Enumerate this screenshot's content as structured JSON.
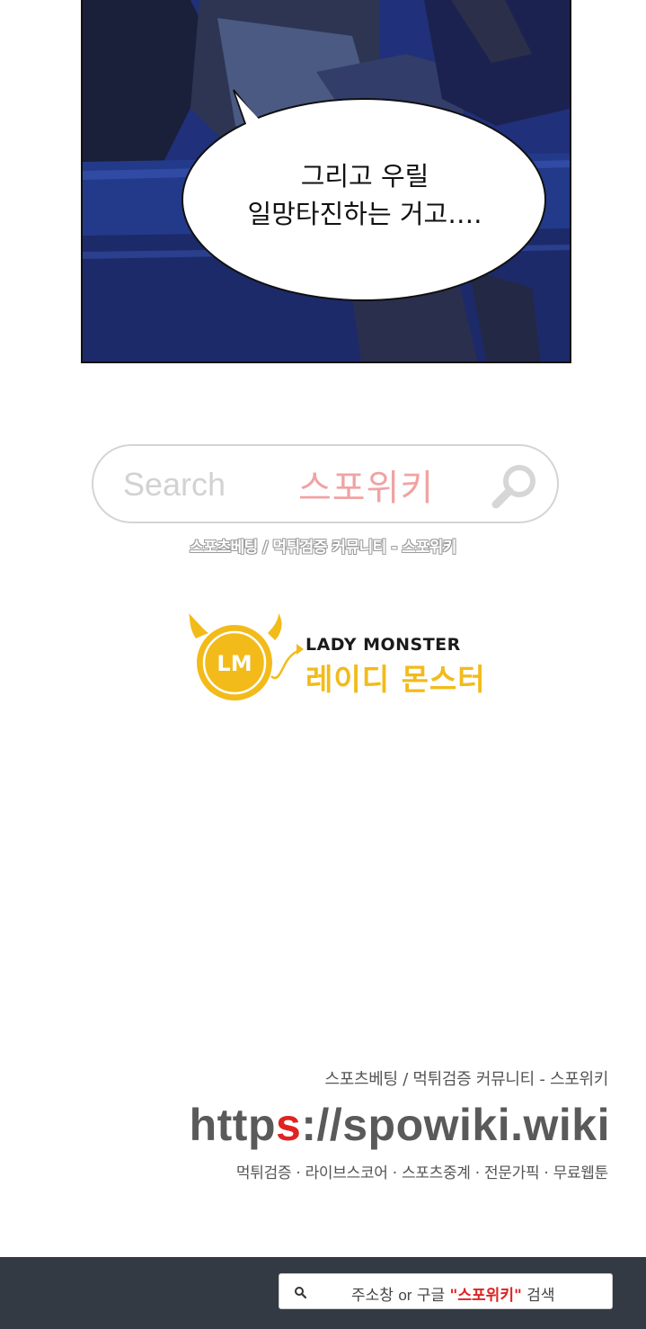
{
  "comic": {
    "speech_line_1": "그리고 우릴",
    "speech_line_2": "일망타진하는 거고…."
  },
  "search_banner": {
    "placeholder": "Search",
    "brand": "스포위키",
    "caption": "스포츠베팅 / 먹튀검증 커뮤니티 - 스포위키"
  },
  "logo": {
    "initials": "LM",
    "name_en": "LADY MONSTER",
    "name_ko": "레이디 몬스터",
    "accent_color": "#f2bb1a"
  },
  "footer": {
    "tagline": "스포츠베팅 / 먹튀검증 커뮤니티 - 스포위키",
    "url_part1": "http",
    "url_accent": "s",
    "url_part2": "://spowiki.wiki",
    "services": "먹튀검증 · 라이브스코어 · 스포츠중계 · 전문가픽 · 무료웹툰"
  },
  "bottom_bar": {
    "hint_prefix": "주소창",
    "hint_or": "or",
    "hint_mid": "구글",
    "hint_keyword": "\"스포위키\"",
    "hint_suffix": "검색"
  }
}
